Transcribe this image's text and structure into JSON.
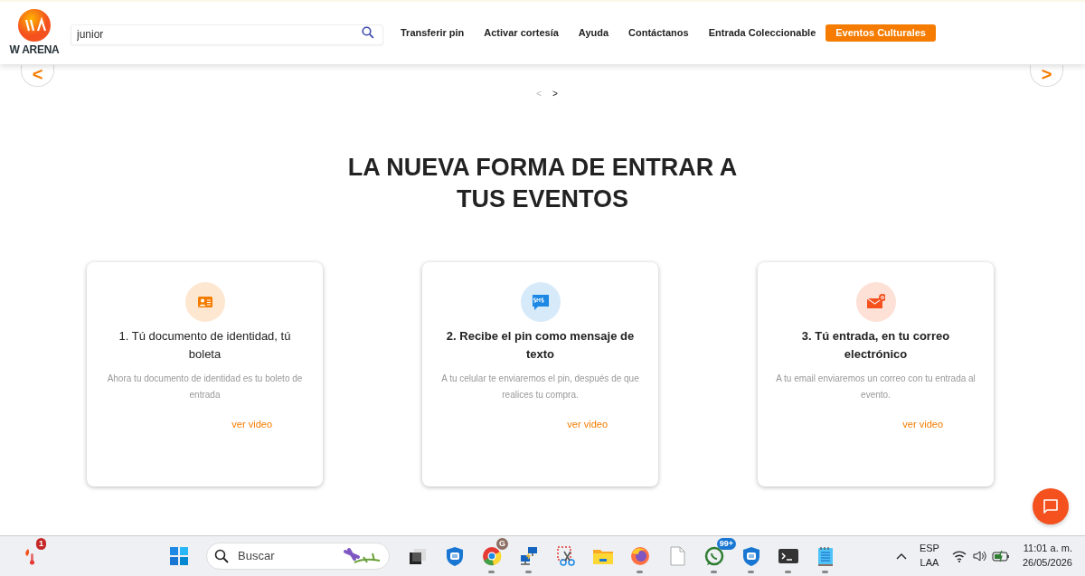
{
  "header": {
    "logo_text": "W ARENA",
    "search": {
      "value": "junior"
    },
    "nav": [
      {
        "label": "Transferir pin",
        "highlighted": false
      },
      {
        "label": "Activar cortesía",
        "highlighted": false
      },
      {
        "label": "Ayuda",
        "highlighted": false
      },
      {
        "label": "Contáctanos",
        "highlighted": false
      },
      {
        "label": "Entrada Coleccionable",
        "highlighted": false
      },
      {
        "label": "Eventos Culturales",
        "highlighted": true
      }
    ]
  },
  "carousel": {
    "prev": "<",
    "next": ">",
    "pager": [
      {
        "label": "<",
        "disabled": true
      },
      {
        "label": ">",
        "disabled": false
      }
    ]
  },
  "heading": "LA NUEVA FORMA DE ENTRAR A TUS EVENTOS",
  "cards": [
    {
      "kind": "id",
      "color": "#f57c00",
      "title": "1. Tú documento de identidad, tú boleta",
      "bold": false,
      "text": "Ahora tu documento de identidad es tu boleto de entrada",
      "link": "ver video"
    },
    {
      "kind": "sms",
      "color": "#1e88e5",
      "title": "2. Recibe el pin como mensaje de texto",
      "bold": true,
      "text": "A tu celular te enviaremos el pin, después de que realices tu compra.",
      "link": "ver video"
    },
    {
      "kind": "email",
      "color": "#f4511e",
      "title": "3. Tú entrada, en tu correo electrónico",
      "bold": true,
      "text": "A tu email enviaremos un correo con tu entrada al evento.",
      "link": "ver video"
    }
  ],
  "taskbar": {
    "widget_badge": "1",
    "search_placeholder": "Buscar",
    "apps": [
      {
        "kind": "windows",
        "running": false
      },
      {
        "kind": "taskview",
        "running": false
      },
      {
        "kind": "shield",
        "running": false
      },
      {
        "kind": "chrome",
        "running": true,
        "badge": "G"
      },
      {
        "kind": "network",
        "running": true
      },
      {
        "kind": "scissors",
        "running": false
      },
      {
        "kind": "folder",
        "running": false
      },
      {
        "kind": "firefox",
        "running": true
      },
      {
        "kind": "file",
        "running": false
      },
      {
        "kind": "whatsapp",
        "running": true,
        "badge": "99+"
      },
      {
        "kind": "shield",
        "running": true
      },
      {
        "kind": "terminal",
        "running": true
      },
      {
        "kind": "notepad",
        "running": true
      }
    ],
    "language": [
      "ESP",
      "LAA"
    ],
    "time": "11:01 a. m.",
    "date": "26/05/2026"
  }
}
